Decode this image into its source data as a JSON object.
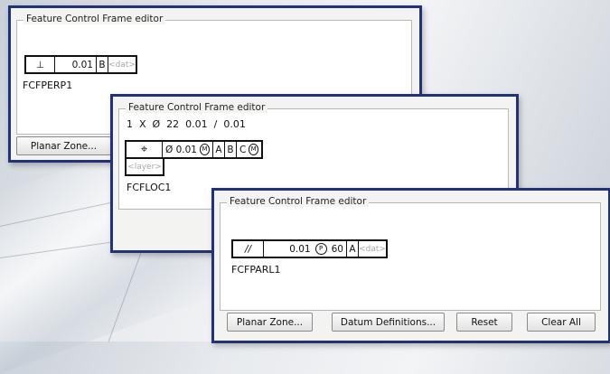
{
  "windows": {
    "perp": {
      "title": "Feature Control Frame editor",
      "frame": {
        "symbol": "⊥",
        "tolerance": "0.01",
        "datum": "B",
        "placeholder": "<dat>"
      },
      "name": "FCFPERP1",
      "buttons": {
        "planar_zone": "Planar Zone..."
      }
    },
    "loc": {
      "title": "Feature Control Frame editor",
      "header_line": "1  X  Ø  22  0.01  /  0.01",
      "frame": {
        "symbol": "⌖",
        "tolerance": "Ø 0.01",
        "modifier": "M",
        "datums": [
          "A",
          "B",
          "C"
        ],
        "datum_modifier": "M",
        "placeholder": "<layer>"
      },
      "name": "FCFLOC1"
    },
    "parl": {
      "title": "Feature Control Frame editor",
      "frame": {
        "symbol": "//",
        "tolerance": "0.01",
        "modifier": "P",
        "projected": "60",
        "datum": "A",
        "placeholder": "<dat>"
      },
      "name": "FCFPARL1",
      "buttons": {
        "planar_zone": "Planar Zone...",
        "datum_definitions": "Datum Definitions...",
        "reset": "Reset",
        "clear_all": "Clear All"
      }
    }
  }
}
